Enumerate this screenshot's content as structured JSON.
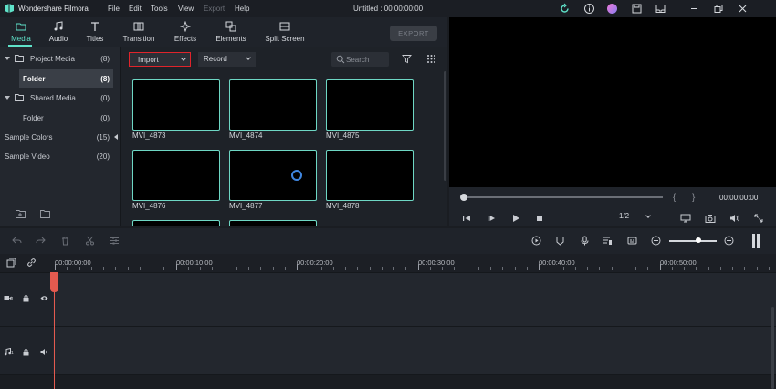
{
  "app": {
    "name": "Wondershare Filmora",
    "window_title": "Untitled : 00:00:00:00",
    "menu": [
      "File",
      "Edit",
      "Tools",
      "View",
      "Export",
      "Help"
    ],
    "disabled_menu": "Export"
  },
  "tabs": [
    {
      "label": "Media",
      "icon": "folder-icon",
      "active": true
    },
    {
      "label": "Audio",
      "icon": "music-note-icon"
    },
    {
      "label": "Titles",
      "icon": "text-t-icon"
    },
    {
      "label": "Transition",
      "icon": "transition-icon"
    },
    {
      "label": "Effects",
      "icon": "effects-icon"
    },
    {
      "label": "Elements",
      "icon": "elements-icon"
    },
    {
      "label": "Split Screen",
      "icon": "split-screen-icon"
    }
  ],
  "export_button": "EXPORT",
  "sidebar": {
    "items": [
      {
        "label": "Project Media",
        "count": "(8)"
      },
      {
        "label": "Folder",
        "count": "(8)",
        "selected": true
      },
      {
        "label": "Shared Media",
        "count": "(0)"
      },
      {
        "label": "Folder",
        "count": "(0)"
      },
      {
        "label": "Sample Colors",
        "count": "(15)"
      },
      {
        "label": "Sample Video",
        "count": "(20)"
      }
    ]
  },
  "media": {
    "import_label": "Import",
    "record_label": "Record",
    "search_placeholder": "Search",
    "clips": [
      "MVI_4873",
      "MVI_4874",
      "MVI_4875",
      "MVI_4876",
      "MVI_4877",
      "MVI_4878"
    ],
    "thumbnail_border_color": "#6ed7c4"
  },
  "preview": {
    "timecode": "00:00:00:00",
    "ratio": "1/2",
    "bracket_left": "{",
    "bracket_right": "}"
  },
  "timeline": {
    "ruler_labels": [
      "00:00:00:00",
      "00:00:10:00",
      "00:00:20:00",
      "00:00:30:00",
      "00:00:40:00",
      "00:00:50:00"
    ],
    "video_track_number": "1",
    "audio_track_number": "1",
    "playhead_color": "#e45a4f"
  },
  "colors": {
    "accent": "#5fe2c9",
    "import_highlight": "#e0242b"
  }
}
